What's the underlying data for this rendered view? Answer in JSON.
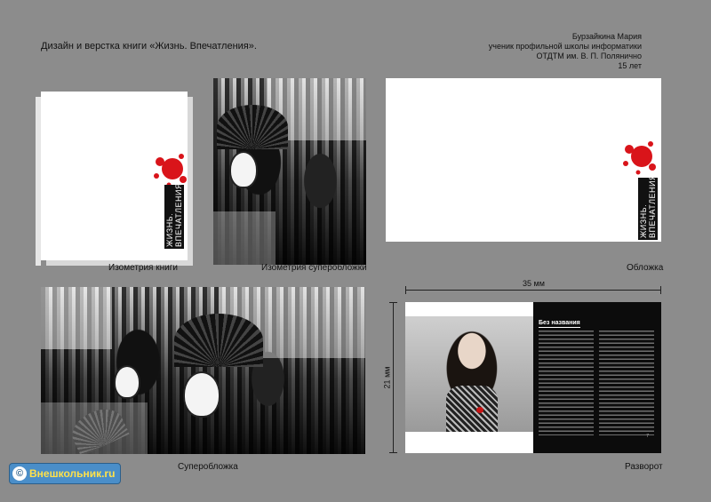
{
  "header": {
    "title": "Дизайн и верстка книги «Жизнь. Впечатления».",
    "author_lines": [
      "Бурзайкина Мария",
      "ученик профильной школы информатики",
      "ОТДТМ им. В. П. Полянично",
      "15 лет"
    ]
  },
  "book_title_vertical": "ЖИЗНЬ. ВПЕЧАТЛЕНИЯ",
  "captions": {
    "book_iso": "Изометрия книги",
    "jacket_iso": "Изометрия суперобложки",
    "cover": "Обложка",
    "jacket": "Суперобложка",
    "spread": "Разворот"
  },
  "dimensions": {
    "width": "35 мм",
    "height": "21 мм"
  },
  "spread": {
    "heading": "Без названия",
    "page_number": "7"
  },
  "logo": {
    "symbol": "©",
    "text": "Внешкольник.ru"
  },
  "colors": {
    "background": "#8c8c8c",
    "splash_red": "#d9141a",
    "page_black": "#0c0c0c"
  }
}
